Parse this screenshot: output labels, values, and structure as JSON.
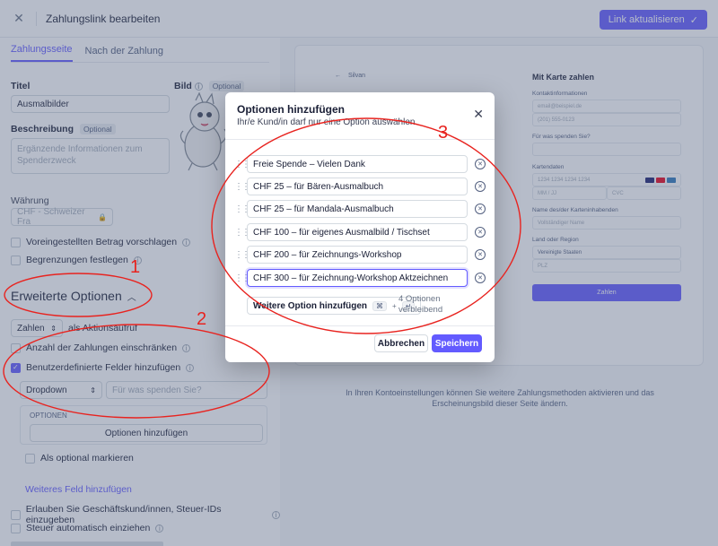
{
  "topbar": {
    "title": "Zahlungslink bearbeiten",
    "update_label": "Link aktualisieren"
  },
  "tabs": [
    "Zahlungsseite",
    "Nach der Zahlung"
  ],
  "form": {
    "title_label": "Titel",
    "title_value": "Ausmalbilder",
    "image_label": "Bild",
    "optional": "Optional",
    "desc_label": "Beschreibung",
    "desc_placeholder": "Ergänzende Informationen zum Spenderzweck",
    "currency_label": "Währung",
    "currency_value": "CHF - Schweizer Fra",
    "preset_amount": "Voreingestellten Betrag vorschlagen",
    "limits": "Begrenzungen festlegen",
    "advanced": "Erweiterte Optionen",
    "pay_select": "Zahlen",
    "pay_suffix": "als Aktionsaufruf",
    "limit_count": "Anzahl der Zahlungen einschränken",
    "custom_fields": "Benutzerdefinierte Felder hinzufügen",
    "dropdown": "Dropdown",
    "dropdown_question_placeholder": "Für was spenden Sie?",
    "options_heading": "OPTIONEN",
    "add_options": "Optionen hinzufügen",
    "mark_optional": "Als optional markieren",
    "add_field": "Weiteres Feld hinzufügen",
    "business_ids": "Erlauben Sie Geschäftskund/innen, Steuer-IDs einzugeben",
    "auto_tax": "Steuer automatisch einziehen"
  },
  "preview": {
    "card_heading": "Mit Karte zahlen",
    "contact": "Kontaktinformationen",
    "email_ph": "email@beispiel.de",
    "phone_ph": "(201) 555-0123",
    "donate_label": "Für was spenden Sie?",
    "card_label": "Kartendaten",
    "card_ph": "1234 1234 1234 1234",
    "exp_ph": "MM / JJ",
    "cvc_ph": "CVC",
    "name_label": "Name des/der Karteninhabenden",
    "name_ph": "Vollständiger Name",
    "country_label": "Land oder Region",
    "country_value": "Vereinigte Staaten",
    "zip_ph": "PLZ",
    "pay_button": "Zahlen",
    "footer_text": "In Ihren Kontoeinstellungen können Sie weitere Zahlungsmethoden aktivieren und das Erscheinungsbild dieser Seite ändern.",
    "sign_in": "Silvan"
  },
  "modal": {
    "title": "Optionen hinzufügen",
    "subtitle": "Ihr/e Kund/in darf nur eine Option auswählen.",
    "options": [
      "Freie Spende – Vielen Dank",
      "CHF 25 – für Bären-Ausmalbuch",
      "CHF 25 – für Mandala-Ausmalbuch",
      "CHF 100 – für eigenes Ausmalbild / Tischset",
      "CHF 200 – für Zeichnungs-Workshop",
      "CHF 300 – für Zeichnung-Workshop Aktzeichnen"
    ],
    "add_option": "Weitere Option hinzufügen",
    "shortcut_a": "⌘",
    "shortcut_plus": "+",
    "shortcut_b": "↵",
    "remaining_line1": "4 Optionen",
    "remaining_line2": "verbleibend",
    "cancel": "Abbrechen",
    "save": "Speichern"
  },
  "annotations": [
    "1",
    "2",
    "3"
  ],
  "colors": {
    "accent": "#635bff",
    "annotation": "#e8231f",
    "overlay": "rgba(82,95,127,0.42)"
  }
}
